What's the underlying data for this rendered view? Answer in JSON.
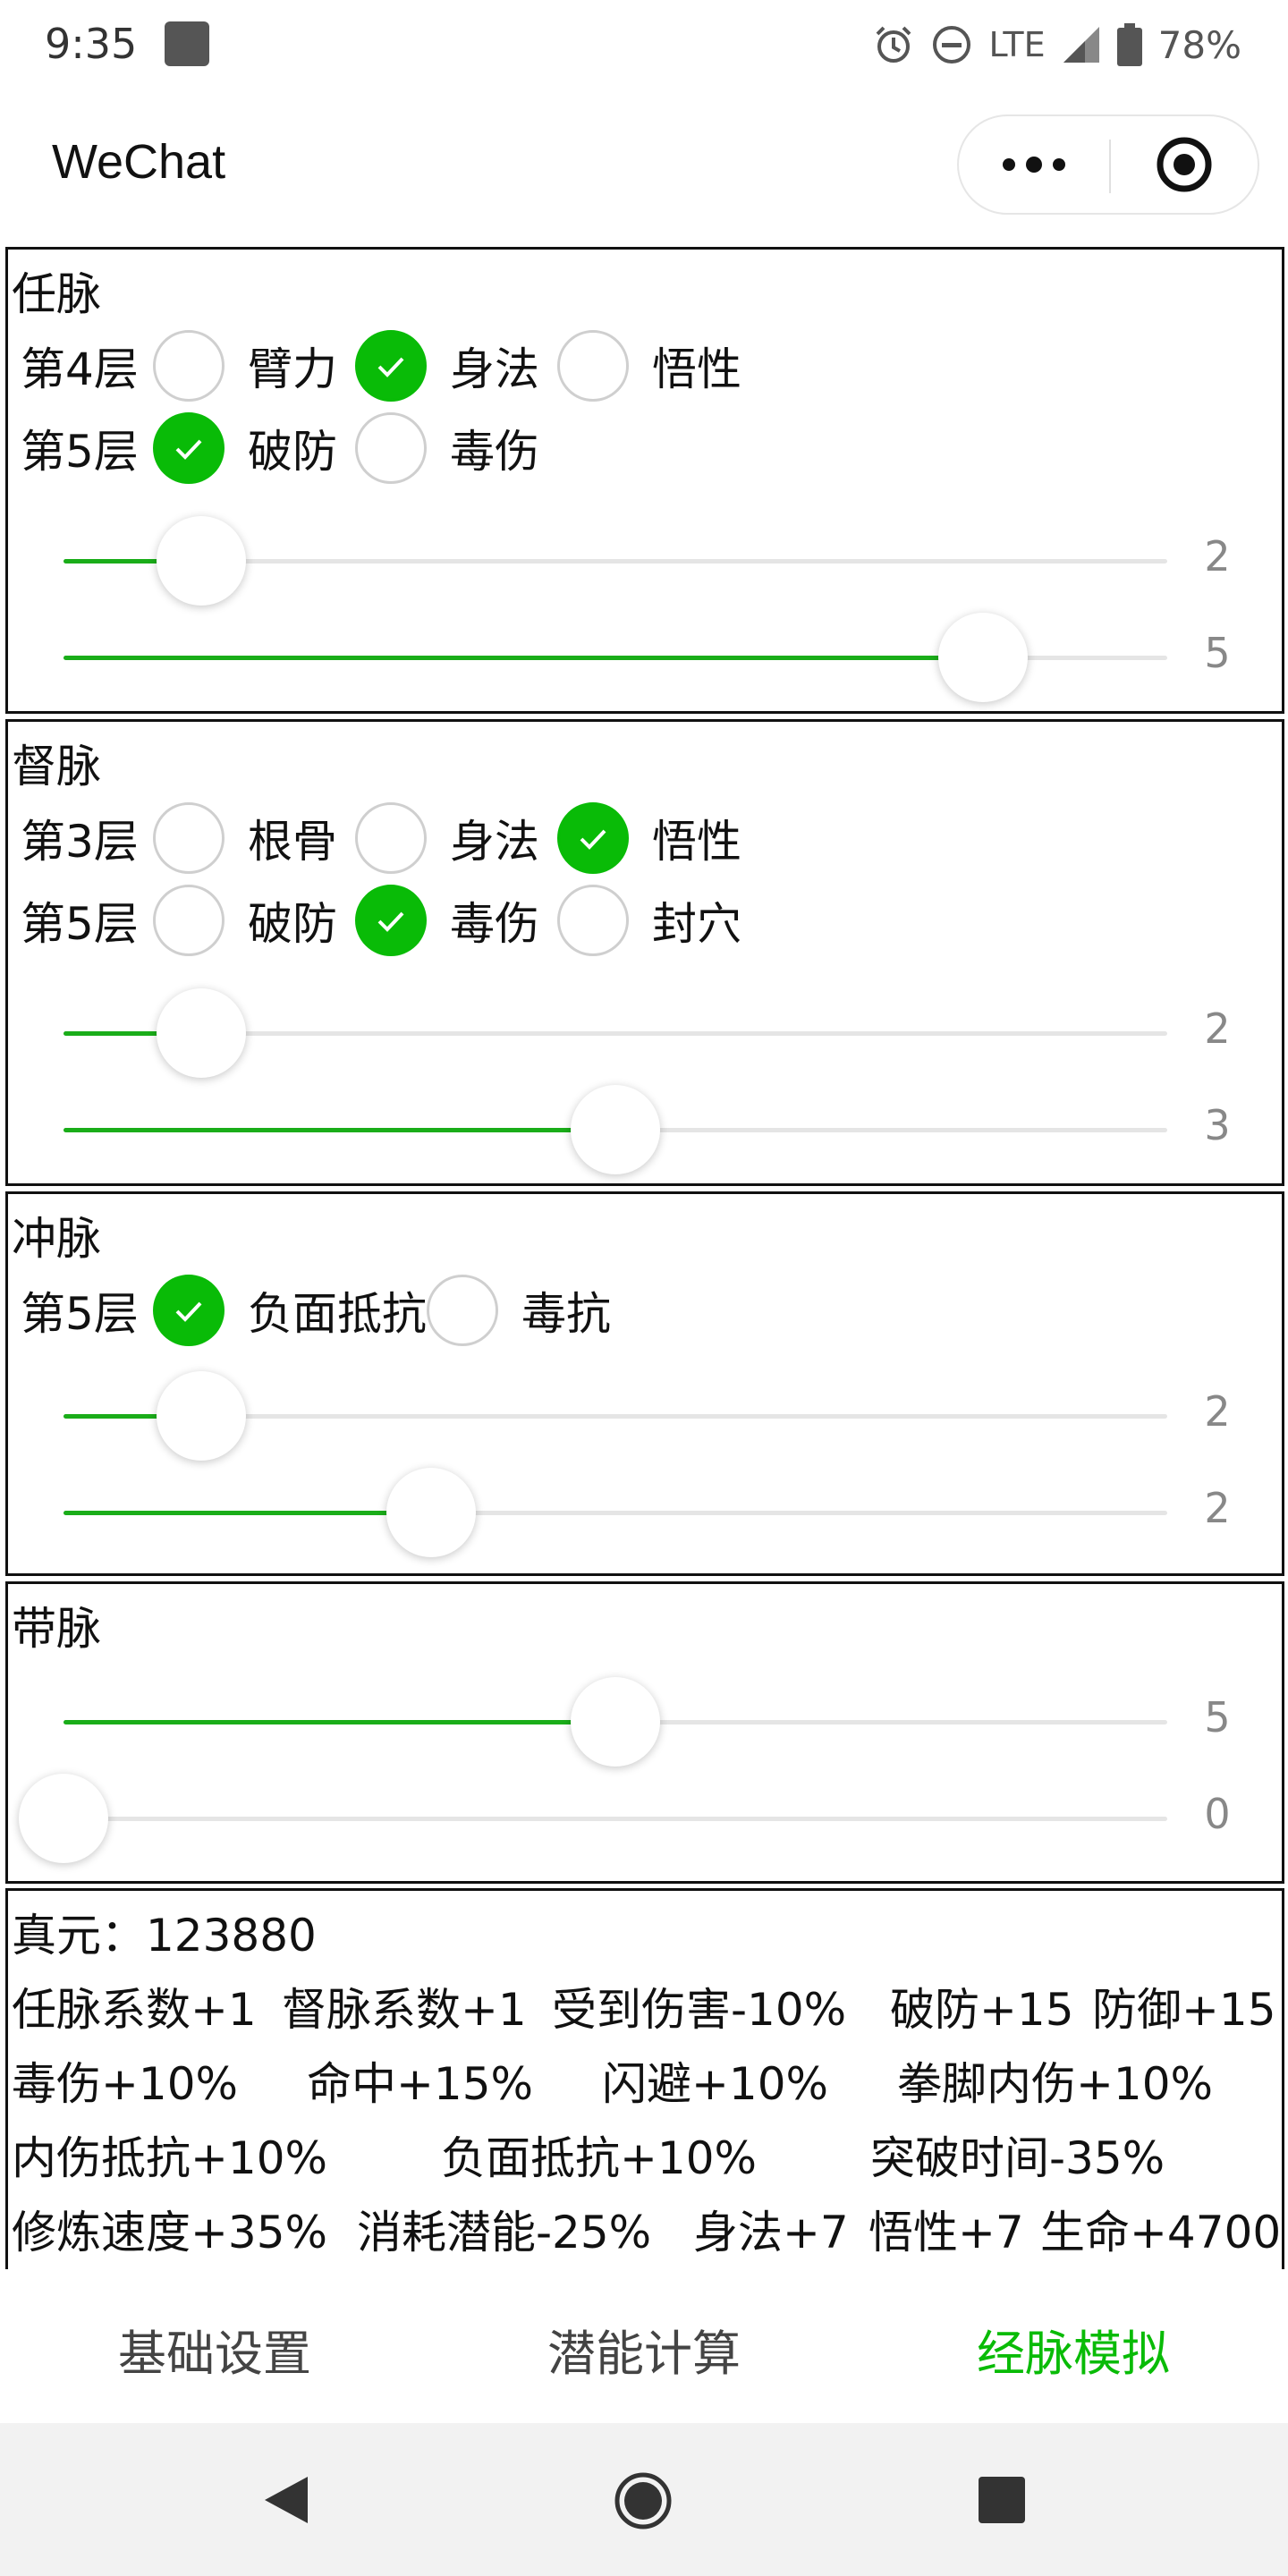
{
  "status_bar": {
    "time": "9:35",
    "network": "LTE",
    "battery": "78%"
  },
  "title_bar": {
    "title": "WeChat"
  },
  "cards": [
    {
      "title": "任脉",
      "rows": [
        {
          "layer": "第4层",
          "options": [
            {
              "label": "臂力",
              "checked": false
            },
            {
              "label": "身法",
              "checked": true
            },
            {
              "label": "悟性",
              "checked": false
            }
          ]
        },
        {
          "layer": "第5层",
          "options": [
            {
              "label": "破防",
              "checked": true
            },
            {
              "label": "毒伤",
              "checked": false
            }
          ]
        }
      ],
      "sliders": [
        {
          "value": "2",
          "fraction": 0.125
        },
        {
          "value": "5",
          "fraction": 0.833
        }
      ]
    },
    {
      "title": "督脉",
      "rows": [
        {
          "layer": "第3层",
          "options": [
            {
              "label": "根骨",
              "checked": false
            },
            {
              "label": "身法",
              "checked": false
            },
            {
              "label": "悟性",
              "checked": true
            }
          ]
        },
        {
          "layer": "第5层",
          "options": [
            {
              "label": "破防",
              "checked": false
            },
            {
              "label": "毒伤",
              "checked": true
            },
            {
              "label": "封穴",
              "checked": false
            }
          ]
        }
      ],
      "sliders": [
        {
          "value": "2",
          "fraction": 0.125
        },
        {
          "value": "3",
          "fraction": 0.5
        }
      ]
    },
    {
      "title": "冲脉",
      "rows": [
        {
          "layer": "第5层",
          "options": [
            {
              "label": "负面抵抗",
              "checked": true
            },
            {
              "label": "毒抗",
              "checked": false
            }
          ]
        }
      ],
      "sliders": [
        {
          "value": "2",
          "fraction": 0.125
        },
        {
          "value": "2",
          "fraction": 0.333
        }
      ]
    },
    {
      "title": "带脉",
      "rows": [],
      "sliders": [
        {
          "value": "5",
          "fraction": 0.5
        },
        {
          "value": "0",
          "fraction": 0.0
        }
      ]
    }
  ],
  "results": {
    "zhenyuan": "真元：123880",
    "lines": [
      [
        "任脉系数+1",
        "督脉系数+1",
        "受到伤害-10%",
        "破防+15",
        "防御+15"
      ],
      [
        "毒伤+10%",
        "命中+15%",
        "闪避+10%",
        "拳脚内伤+10%"
      ],
      [
        "内伤抵抗+10%",
        "负面抵抗+10%",
        "突破时间-35%"
      ],
      [
        "修炼速度+35%",
        "消耗潜能-25%",
        "身法+7",
        "悟性+7",
        "生命+4700"
      ]
    ]
  },
  "tabbar": {
    "tabs": [
      {
        "label": "基础设置",
        "active": false
      },
      {
        "label": "潜能计算",
        "active": false
      },
      {
        "label": "经脉模拟",
        "active": true
      }
    ]
  },
  "colors": {
    "accent": "#09bb07",
    "slider_fill": "#1aad19",
    "tab_active": "#09bb07"
  }
}
